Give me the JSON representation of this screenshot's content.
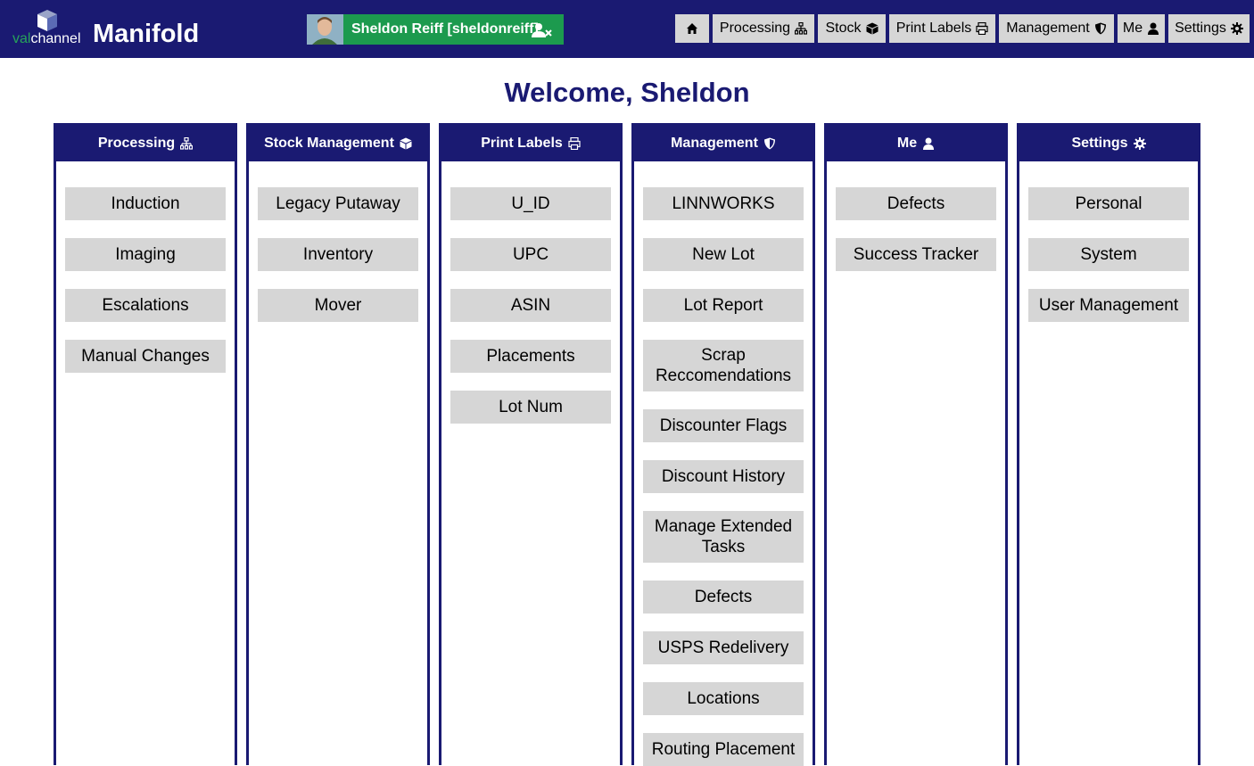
{
  "brand": {
    "logo_prefix": "val",
    "logo_suffix": "channel",
    "app_title": "Manifold"
  },
  "user": {
    "display": "Sheldon Reiff [sheldonreiff]"
  },
  "nav": [
    {
      "label": "",
      "icon": "home-icon"
    },
    {
      "label": "Processing",
      "icon": "sitemap-icon"
    },
    {
      "label": "Stock",
      "icon": "box-icon"
    },
    {
      "label": "Print Labels",
      "icon": "printer-icon"
    },
    {
      "label": "Management",
      "icon": "shield-icon"
    },
    {
      "label": "Me",
      "icon": "user-icon"
    },
    {
      "label": "Settings",
      "icon": "gear-icon"
    }
  ],
  "welcome": "Welcome, Sheldon",
  "columns": [
    {
      "title": "Processing",
      "icon": "sitemap-icon",
      "items": [
        "Induction",
        "Imaging",
        "Escalations",
        "Manual Changes"
      ]
    },
    {
      "title": "Stock Management",
      "icon": "box-icon",
      "items": [
        "Legacy Putaway",
        "Inventory",
        "Mover"
      ]
    },
    {
      "title": "Print Labels",
      "icon": "printer-icon",
      "items": [
        "U_ID",
        "UPC",
        "ASIN",
        "Placements",
        "Lot Num"
      ]
    },
    {
      "title": "Management",
      "icon": "shield-icon",
      "items": [
        "LINNWORKS",
        "New Lot",
        "Lot Report",
        "Scrap Reccomendations",
        "Discounter Flags",
        "Discount History",
        "Manage Extended Tasks",
        "Defects",
        "USPS Redelivery",
        "Locations",
        "Routing Placement"
      ]
    },
    {
      "title": "Me",
      "icon": "user-icon",
      "items": [
        "Defects",
        "Success Tracker"
      ]
    },
    {
      "title": "Settings",
      "icon": "gear-icon",
      "items": [
        "Personal",
        "System",
        "User Management"
      ]
    }
  ],
  "colors": {
    "navy": "#1a1a72",
    "green": "#1c9a4e",
    "button_gray": "#d6d6d6"
  }
}
